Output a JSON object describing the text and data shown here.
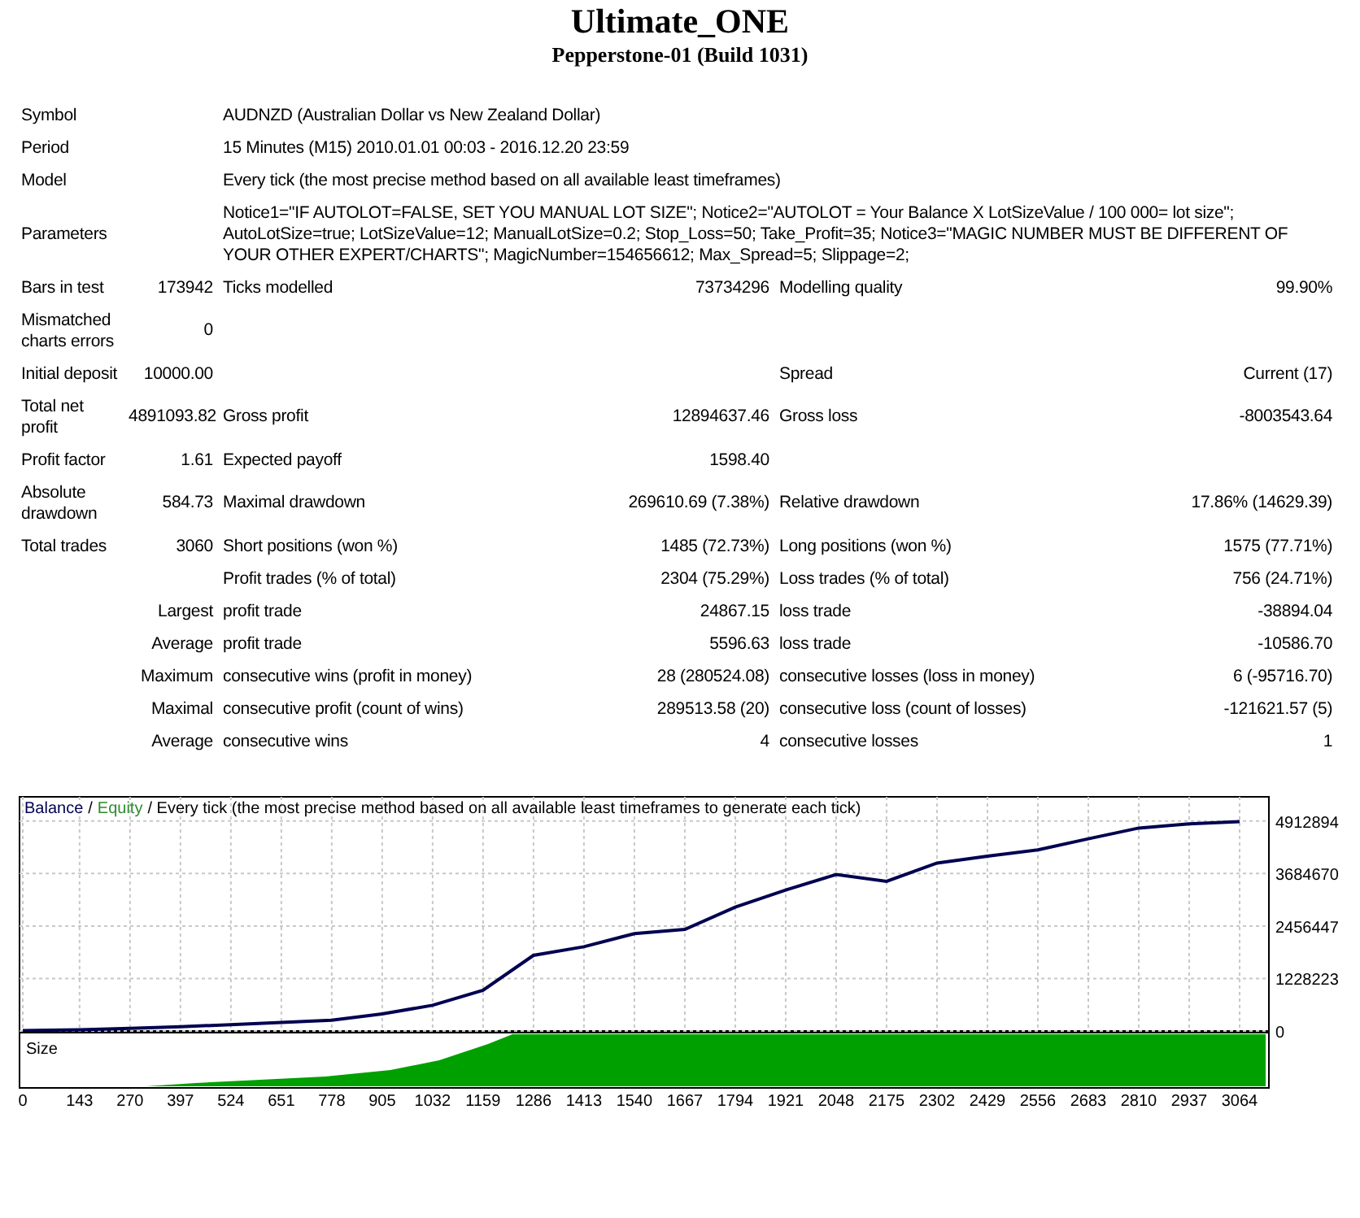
{
  "title": "Ultimate_ONE",
  "subtitle": "Pepperstone-01 (Build 1031)",
  "info_rows": [
    {
      "label": "Symbol",
      "value": "AUDNZD (Australian Dollar vs New Zealand Dollar)"
    },
    {
      "label": "Period",
      "value": "15 Minutes (M15) 2010.01.01 00:03 - 2016.12.20 23:59"
    },
    {
      "label": "Model",
      "value": "Every tick (the most precise method based on all available least timeframes)"
    },
    {
      "label": "Parameters",
      "value": "Notice1=\"IF AUTOLOT=FALSE, SET YOU MANUAL LOT SIZE\"; Notice2=\"AUTOLOT = Your Balance X LotSizeValue / 100 000= lot size\"; AutoLotSize=true; LotSizeValue=12; ManualLotSize=0.2; Stop_Loss=50; Take_Profit=35; Notice3=\"MAGIC NUMBER MUST BE DIFFERENT OF YOUR OTHER EXPERT/CHARTS\"; MagicNumber=154656612; Max_Spread=5; Slippage=2;"
    }
  ],
  "stats_rows": [
    {
      "c1": "Bars in test",
      "c2": "173942",
      "c3": "Ticks modelled",
      "c4": "73734296",
      "c5": "Modelling quality",
      "c6": "99.90%"
    },
    {
      "c1": "Mismatched charts errors",
      "c2": "0"
    },
    {
      "c1": "Initial deposit",
      "c2": "10000.00",
      "c5": "Spread",
      "c6": "Current (17)"
    },
    {
      "c1": "Total net profit",
      "c2": "4891093.82",
      "c3": "Gross profit",
      "c4": "12894637.46",
      "c5": "Gross loss",
      "c6": "-8003543.64"
    },
    {
      "c1": "Profit factor",
      "c2": "1.61",
      "c3": "Expected payoff",
      "c4": "1598.40"
    },
    {
      "c1": "Absolute drawdown",
      "c2": "584.73",
      "c3": "Maximal drawdown",
      "c4": "269610.69 (7.38%)",
      "c5": "Relative drawdown",
      "c6": "17.86% (14629.39)"
    },
    {
      "c1": "Total trades",
      "c2": "3060",
      "c3": "Short positions (won %)",
      "c4": "1485 (72.73%)",
      "c5": "Long positions (won %)",
      "c6": "1575 (77.71%)"
    },
    {
      "c3": "Profit trades (% of total)",
      "c4": "2304 (75.29%)",
      "c5": "Loss trades (% of total)",
      "c6": "756 (24.71%)"
    },
    {
      "c2": "Largest",
      "c3": "profit trade",
      "c4": "24867.15",
      "c5": "loss trade",
      "c6": "-38894.04"
    },
    {
      "c2": "Average",
      "c3": "profit trade",
      "c4": "5596.63",
      "c5": "loss trade",
      "c6": "-10586.70"
    },
    {
      "c2": "Maximum",
      "c3": "consecutive wins (profit in money)",
      "c4": "28 (280524.08)",
      "c5": "consecutive losses (loss in money)",
      "c6": "6 (-95716.70)"
    },
    {
      "c2": "Maximal",
      "c3": "consecutive profit (count of wins)",
      "c4": "289513.58 (20)",
      "c5": "consecutive loss (count of losses)",
      "c6": "-121621.57 (5)"
    },
    {
      "c2": "Average",
      "c3": "consecutive wins",
      "c4": "4",
      "c5": "consecutive losses",
      "c6": "1"
    }
  ],
  "chart": {
    "legend": [
      {
        "text": "/",
        "color": "#000000"
      },
      {
        "text": "Equity",
        "color": "#2e8b2e"
      },
      {
        "text": "/ Every tick (the most precise method based on all available least timeframes to generate each tick)",
        "color": "#000000"
      }
    ],
    "size_label": "Size",
    "chart_data": {
      "type": "line",
      "x": [
        0,
        143,
        270,
        397,
        524,
        651,
        778,
        905,
        1032,
        1159,
        1286,
        1413,
        1540,
        1667,
        1794,
        1921,
        2048,
        2175,
        2302,
        2429,
        2556,
        2683,
        2810,
        2937,
        3064
      ],
      "series": [
        {
          "name": "Balance",
          "color": "#000050",
          "values": [
            10000,
            30000,
            60000,
            100000,
            150000,
            200000,
            250000,
            400000,
            600000,
            950000,
            1770000,
            1970000,
            2280000,
            2380000,
            2900000,
            3300000,
            3660000,
            3500000,
            3930000,
            4090000,
            4240000,
            4500000,
            4750000,
            4850000,
            4900000
          ]
        }
      ],
      "xticks": [
        0,
        143,
        270,
        397,
        524,
        651,
        778,
        905,
        1032,
        1159,
        1286,
        1413,
        1540,
        1667,
        1794,
        1921,
        2048,
        2175,
        2302,
        2429,
        2556,
        2683,
        2810,
        2937,
        3064
      ],
      "yticks": [
        0,
        1228223,
        2456447,
        3684670,
        4912894
      ],
      "xlim": [
        0,
        3064
      ],
      "ylim": [
        0,
        5480000
      ],
      "grid": true
    }
  }
}
